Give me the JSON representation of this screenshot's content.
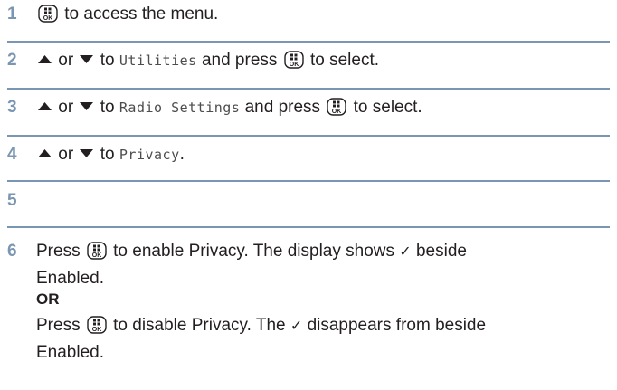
{
  "steps": [
    {
      "number": "1",
      "text_a": "to access the menu."
    },
    {
      "number": "2",
      "or": "or",
      "to": "to",
      "menu_item": "Utilities",
      "text_a": "and press",
      "text_b": "to select."
    },
    {
      "number": "3",
      "or": "or",
      "to": "to",
      "menu_item": "Radio Settings",
      "text_a": "and press",
      "text_b": "to select."
    },
    {
      "number": "4",
      "or": "or",
      "to": "to",
      "menu_item": "Privacy",
      "text_a": "."
    },
    {
      "number": "5"
    },
    {
      "number": "6",
      "press": "Press",
      "enable_text": "to enable Privacy. The display shows",
      "enable_text_b": "beside",
      "enable_text_c": "Enabled.",
      "or_label": "OR",
      "disable_text": "to disable Privacy. The",
      "disable_text_b": "disappears from beside",
      "disable_text_c": "Enabled.",
      "check_mark": "✓"
    }
  ],
  "icons": {
    "menu_ok_key": "menu-ok-key-icon",
    "up_arrow": "up-arrow-icon",
    "down_arrow": "down-arrow-icon"
  },
  "colors": {
    "step_number": "#7a96b0",
    "divider": "#7a96b0",
    "text": "#231f20"
  }
}
